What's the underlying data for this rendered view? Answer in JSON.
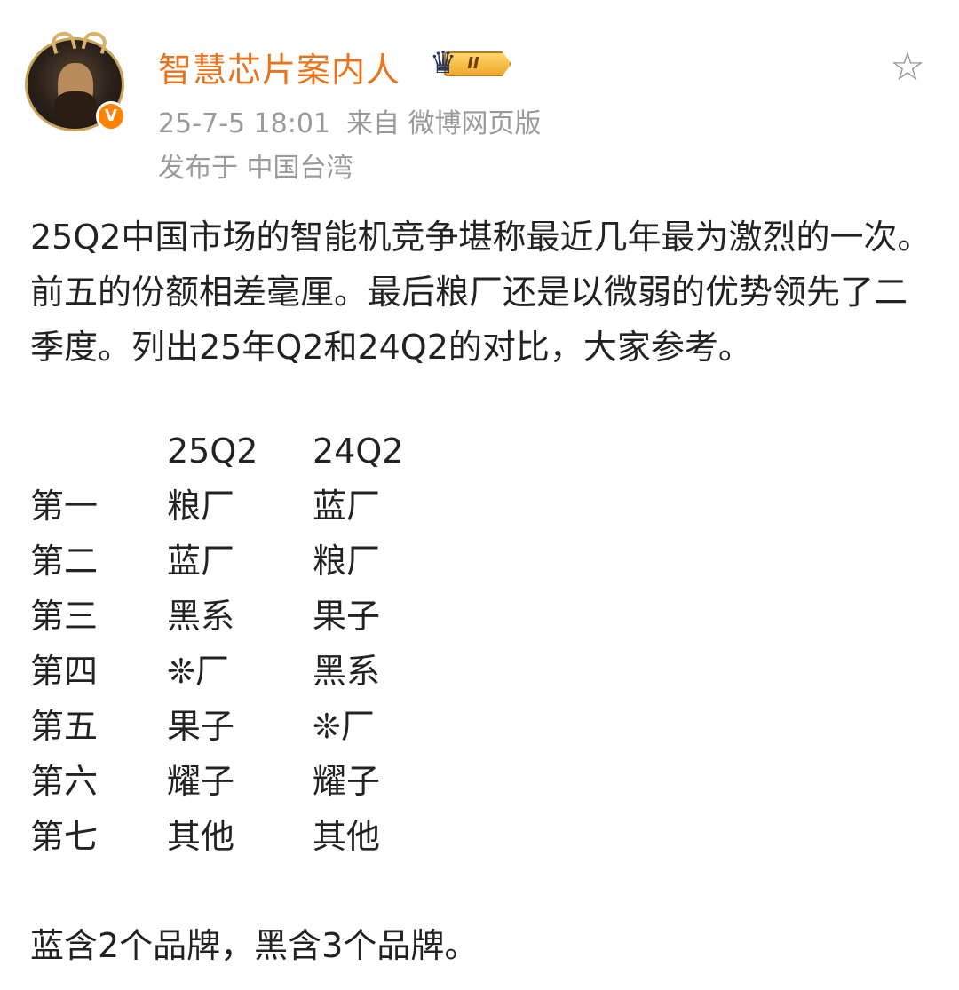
{
  "post": {
    "username": "智慧芯片案内人",
    "badge_text": "II",
    "verified_mark": "V",
    "timestamp": "25-7-5 18:01",
    "source": "来自 微博网页版",
    "location": "发布于 中国台湾",
    "body": "25Q2中国市场的智能机竞争堪称最近几年最为激烈的一次。前五的份额相差毫厘。最后粮厂还是以微弱的优势领先了二季度。列出25年Q2和24Q2的对比，大家参考。",
    "note": "蓝含2个品牌，黑含3个品牌。"
  },
  "table": {
    "headers": [
      "",
      "25Q2",
      "24Q2"
    ],
    "rows": [
      [
        "第一",
        "粮厂",
        "蓝厂"
      ],
      [
        "第二",
        "蓝厂",
        "粮厂"
      ],
      [
        "第三",
        "黑系",
        "果子"
      ],
      [
        "第四",
        "❊厂",
        "黑系"
      ],
      [
        "第五",
        "果子",
        "❊厂"
      ],
      [
        "第六",
        "耀子",
        "耀子"
      ],
      [
        "第七",
        "其他",
        "其他"
      ]
    ]
  },
  "icons": {
    "favorite": "star-outline-icon",
    "verified": "verified-v-icon",
    "member_badge": "crown-badge-icon"
  },
  "colors": {
    "username": "#e8731c",
    "meta": "#9a9a9a",
    "verified_badge": "#ff8200"
  }
}
